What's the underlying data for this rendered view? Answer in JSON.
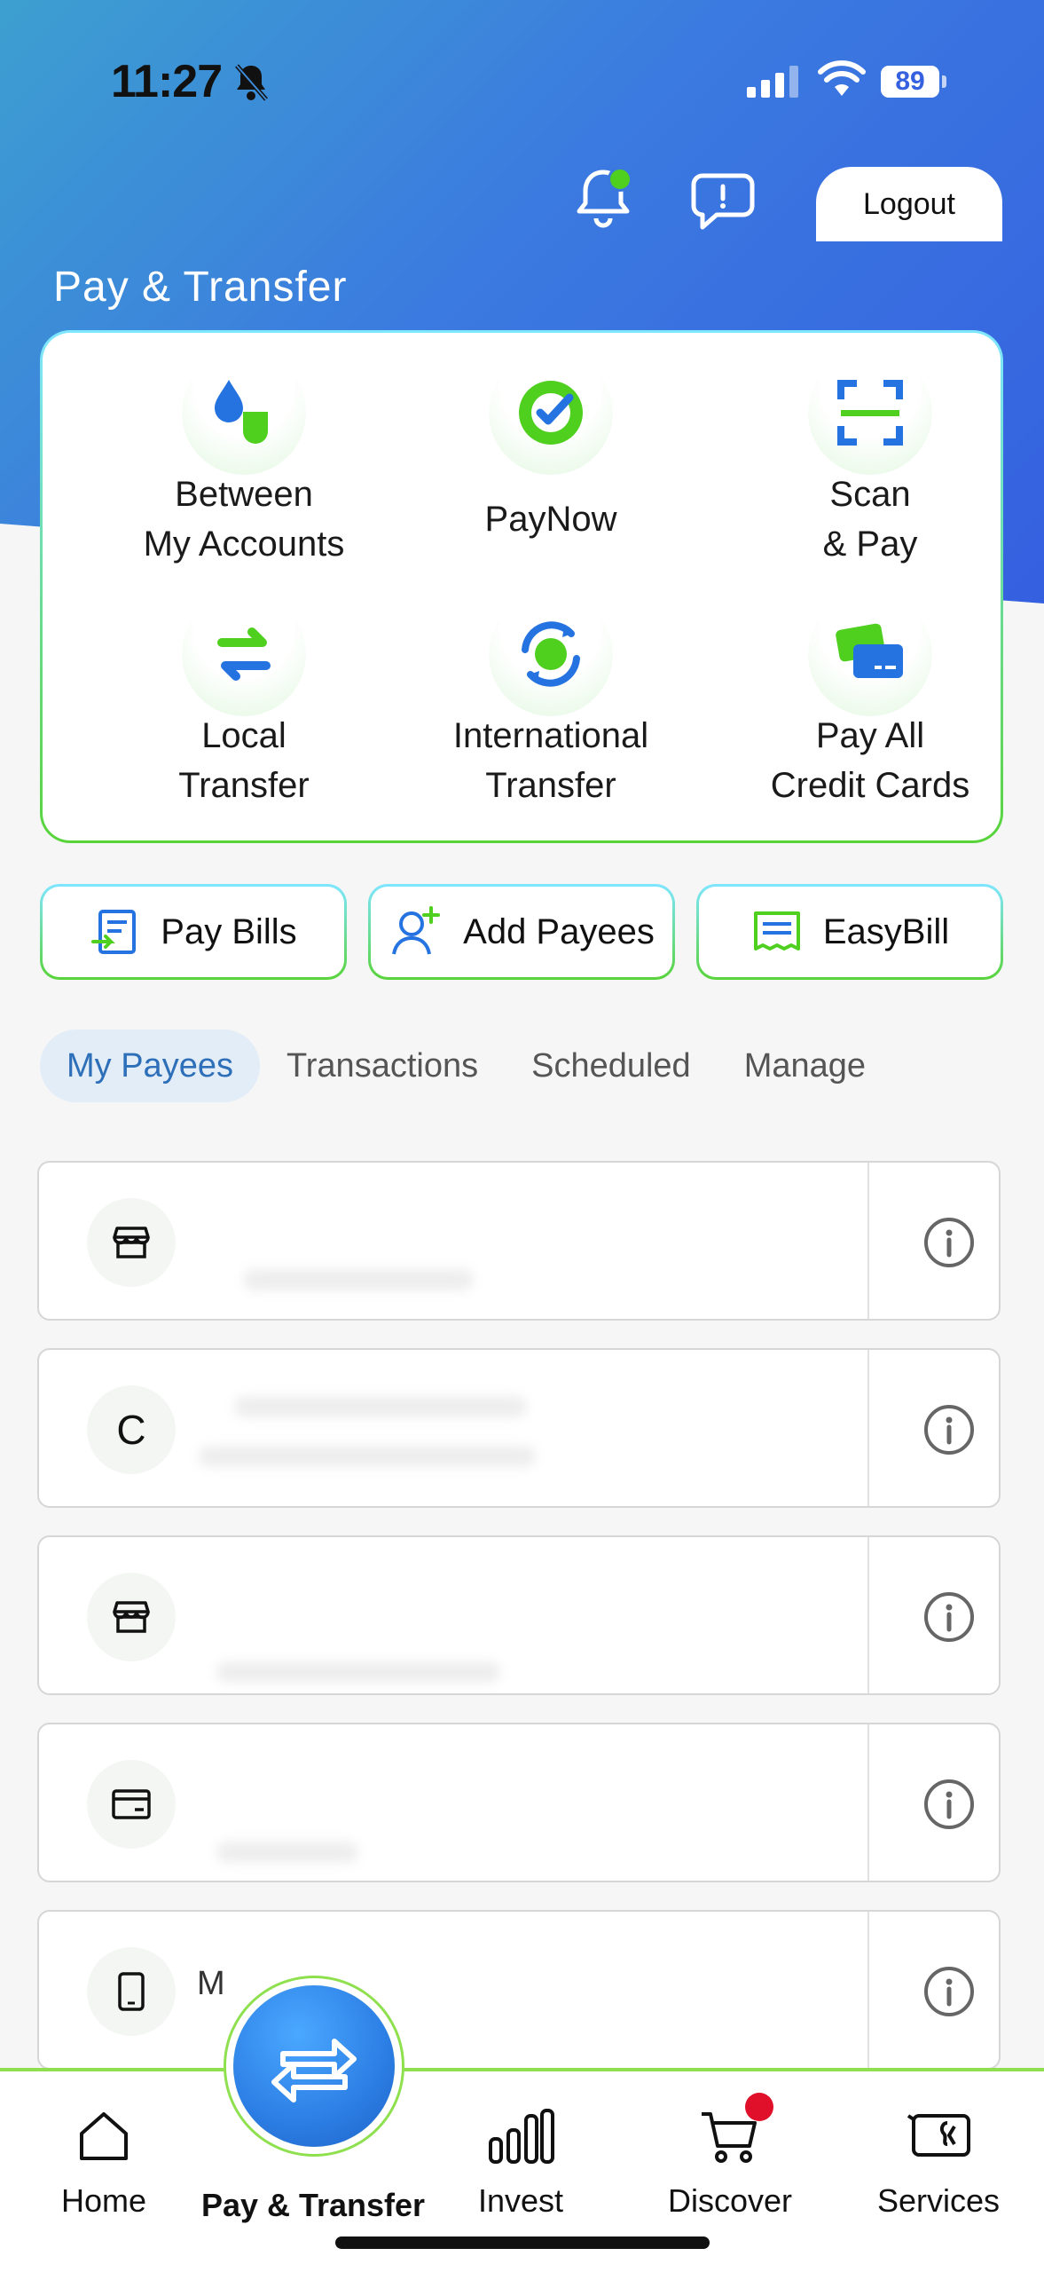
{
  "status": {
    "time": "11:27",
    "battery": "89"
  },
  "header": {
    "logout_label": "Logout",
    "title": "Pay & Transfer"
  },
  "actions": [
    {
      "label": "Between\nMy Accounts",
      "icon": "between-accounts-icon"
    },
    {
      "label": "PayNow",
      "icon": "paynow-icon"
    },
    {
      "label": "Scan\n& Pay",
      "icon": "scan-icon"
    },
    {
      "label": "Local\nTransfer",
      "icon": "local-transfer-icon"
    },
    {
      "label": "International\nTransfer",
      "icon": "international-transfer-icon"
    },
    {
      "label": "Pay All\nCredit Cards",
      "icon": "credit-card-icon"
    }
  ],
  "quick_buttons": [
    {
      "label": "Pay Bills",
      "icon": "bill-icon"
    },
    {
      "label": "Add Payees",
      "icon": "add-user-icon"
    },
    {
      "label": "EasyBill",
      "icon": "receipt-icon"
    }
  ],
  "tabs": [
    {
      "label": "My Payees",
      "active": true
    },
    {
      "label": "Transactions",
      "active": false
    },
    {
      "label": "Scheduled",
      "active": false
    },
    {
      "label": "Manage",
      "active": false
    }
  ],
  "payees": [
    {
      "avatar": "store-icon",
      "initial": "",
      "name": ""
    },
    {
      "avatar": "initial",
      "initial": "C",
      "name": ""
    },
    {
      "avatar": "store-icon",
      "initial": "",
      "name": ""
    },
    {
      "avatar": "card-icon",
      "initial": "",
      "name": ""
    },
    {
      "avatar": "phone-icon",
      "initial": "",
      "name": "M"
    }
  ],
  "bottom_nav": [
    {
      "label": "Home",
      "icon": "home-icon"
    },
    {
      "label": "Pay & Transfer",
      "icon": "transfer-icon"
    },
    {
      "label": "Invest",
      "icon": "invest-icon"
    },
    {
      "label": "Discover",
      "icon": "cart-icon"
    },
    {
      "label": "Services",
      "icon": "services-icon"
    }
  ],
  "colors": {
    "accent_blue": "#2c7ee4",
    "accent_green": "#58d43a",
    "active_tab": "#2d6fb8"
  }
}
